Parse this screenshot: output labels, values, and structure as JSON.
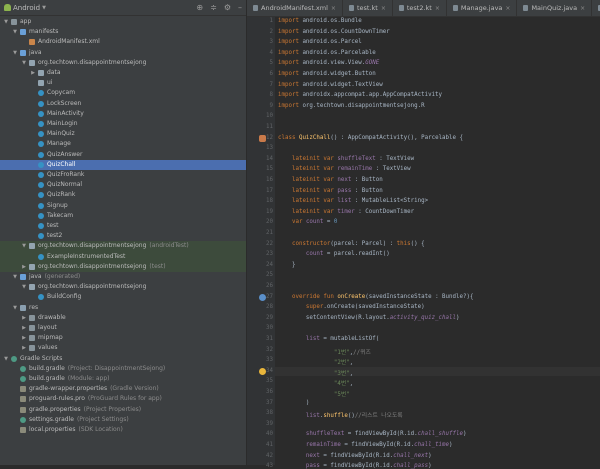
{
  "project": {
    "view_mode": "Android",
    "tree": [
      {
        "label": "app",
        "level": 0,
        "icon": "folder",
        "arrow": "open"
      },
      {
        "label": "manifests",
        "level": 1,
        "icon": "folder-blue",
        "arrow": "open"
      },
      {
        "label": "AndroidManifest.xml",
        "level": 2,
        "icon": "xml",
        "arrow": ""
      },
      {
        "label": "java",
        "level": 1,
        "icon": "folder-blue",
        "arrow": "open"
      },
      {
        "label": "org.techtown.disappointmentsejong",
        "level": 2,
        "icon": "pkg",
        "arrow": "open"
      },
      {
        "label": "data",
        "level": 3,
        "icon": "pkg",
        "arrow": "closed"
      },
      {
        "label": "ui",
        "level": 3,
        "icon": "pkg",
        "arrow": ""
      },
      {
        "label": "Copycam",
        "level": 3,
        "icon": "cls",
        "arrow": ""
      },
      {
        "label": "LockScreen",
        "level": 3,
        "icon": "cls",
        "arrow": ""
      },
      {
        "label": "MainActivity",
        "level": 3,
        "icon": "cls",
        "arrow": ""
      },
      {
        "label": "MainLogin",
        "level": 3,
        "icon": "cls",
        "arrow": ""
      },
      {
        "label": "MainQuiz",
        "level": 3,
        "icon": "cls",
        "arrow": ""
      },
      {
        "label": "Manage",
        "level": 3,
        "icon": "cls",
        "arrow": ""
      },
      {
        "label": "QuizAnswer",
        "level": 3,
        "icon": "cls",
        "arrow": ""
      },
      {
        "label": "QuizChall",
        "level": 3,
        "icon": "cls",
        "arrow": "",
        "selected": true
      },
      {
        "label": "QuizFroRank",
        "level": 3,
        "icon": "cls",
        "arrow": ""
      },
      {
        "label": "QuizNormal",
        "level": 3,
        "icon": "cls",
        "arrow": ""
      },
      {
        "label": "QuizRank",
        "level": 3,
        "icon": "cls",
        "arrow": ""
      },
      {
        "label": "Signup",
        "level": 3,
        "icon": "cls",
        "arrow": ""
      },
      {
        "label": "Takecam",
        "level": 3,
        "icon": "cls",
        "arrow": ""
      },
      {
        "label": "test",
        "level": 3,
        "icon": "cls",
        "arrow": ""
      },
      {
        "label": "test2",
        "level": 3,
        "icon": "cls",
        "arrow": ""
      },
      {
        "label": "org.techtown.disappointmentsejong",
        "hint": "(androidTest)",
        "level": 2,
        "icon": "pkg",
        "arrow": "open",
        "test": true
      },
      {
        "label": "ExampleInstrumentedTest",
        "level": 3,
        "icon": "cls",
        "arrow": "",
        "test": true
      },
      {
        "label": "org.techtown.disappointmentsejong",
        "hint": "(test)",
        "level": 2,
        "icon": "pkg",
        "arrow": "closed",
        "test": true
      },
      {
        "label": "java",
        "hint": "(generated)",
        "level": 1,
        "icon": "folder-blue",
        "arrow": "open"
      },
      {
        "label": "org.techtown.disappointmentsejong",
        "level": 2,
        "icon": "pkg",
        "arrow": "open"
      },
      {
        "label": "BuildConfig",
        "level": 3,
        "icon": "cls",
        "arrow": ""
      },
      {
        "label": "res",
        "level": 1,
        "icon": "res",
        "arrow": "open"
      },
      {
        "label": "drawable",
        "level": 2,
        "icon": "folder",
        "arrow": "closed"
      },
      {
        "label": "layout",
        "level": 2,
        "icon": "folder",
        "arrow": "closed"
      },
      {
        "label": "mipmap",
        "level": 2,
        "icon": "folder",
        "arrow": "closed"
      },
      {
        "label": "values",
        "level": 2,
        "icon": "folder",
        "arrow": "closed"
      },
      {
        "label": "Gradle Scripts",
        "level": 0,
        "icon": "gradle",
        "arrow": "open"
      },
      {
        "label": "build.gradle",
        "hint": "(Project: DisappointmentSejong)",
        "level": 1,
        "icon": "gradle",
        "arrow": ""
      },
      {
        "label": "build.gradle",
        "hint": "(Module: app)",
        "level": 1,
        "icon": "gradle",
        "arrow": ""
      },
      {
        "label": "gradle-wrapper.properties",
        "hint": "(Gradle Version)",
        "level": 1,
        "icon": "file",
        "arrow": ""
      },
      {
        "label": "proguard-rules.pro",
        "hint": "(ProGuard Rules for app)",
        "level": 1,
        "icon": "file",
        "arrow": ""
      },
      {
        "label": "gradle.properties",
        "hint": "(Project Properties)",
        "level": 1,
        "icon": "file",
        "arrow": ""
      },
      {
        "label": "settings.gradle",
        "hint": "(Project Settings)",
        "level": 1,
        "icon": "gradle",
        "arrow": ""
      },
      {
        "label": "local.properties",
        "hint": "(SDK Location)",
        "level": 1,
        "icon": "file",
        "arrow": ""
      }
    ]
  },
  "tabs": [
    {
      "label": "AndroidManifest.xml",
      "active": false
    },
    {
      "label": "test.kt",
      "active": false
    },
    {
      "label": "test2.kt",
      "active": false
    },
    {
      "label": "Manage.java",
      "active": false
    },
    {
      "label": "MainQuiz.java",
      "active": false
    },
    {
      "label": "MainActivity.j",
      "active": false
    }
  ],
  "code": {
    "start_line": 1,
    "highlight_line": 34,
    "lines": [
      [
        [
          "kw",
          "import "
        ],
        [
          "",
          "android.os.Bundle"
        ]
      ],
      [
        [
          "kw",
          "import "
        ],
        [
          "",
          "android.os.CountDownTimer"
        ]
      ],
      [
        [
          "kw",
          "import "
        ],
        [
          "",
          "android.os.Parcel"
        ]
      ],
      [
        [
          "kw",
          "import "
        ],
        [
          "",
          "android.os.Parcelable"
        ]
      ],
      [
        [
          "kw",
          "import "
        ],
        [
          "",
          "android.view.View."
        ],
        [
          "ital",
          "GONE"
        ]
      ],
      [
        [
          "kw",
          "import "
        ],
        [
          "",
          "android.widget.Button"
        ]
      ],
      [
        [
          "kw",
          "import "
        ],
        [
          "",
          "android.widget.TextView"
        ]
      ],
      [
        [
          "kw",
          "import "
        ],
        [
          "",
          "androidx.appcompat.app.AppCompatActivity"
        ]
      ],
      [
        [
          "kw",
          "import "
        ],
        [
          "",
          "org.techtown.disappointmentsejong.R"
        ]
      ],
      [],
      [],
      [
        [
          "kw",
          "class "
        ],
        [
          "fn",
          "QuizChall"
        ],
        [
          "",
          "() : AppCompatActivity(), Parcelable {"
        ]
      ],
      [],
      [
        [
          "",
          "    "
        ],
        [
          "kw",
          "lateinit var "
        ],
        [
          "prop",
          "shuffleText"
        ],
        [
          "",
          " : TextView"
        ]
      ],
      [
        [
          "",
          "    "
        ],
        [
          "kw",
          "lateinit var "
        ],
        [
          "prop",
          "remainTime"
        ],
        [
          "",
          " : TextView"
        ]
      ],
      [
        [
          "",
          "    "
        ],
        [
          "kw",
          "lateinit var "
        ],
        [
          "prop",
          "next"
        ],
        [
          "",
          " : Button"
        ]
      ],
      [
        [
          "",
          "    "
        ],
        [
          "kw",
          "lateinit var "
        ],
        [
          "prop",
          "pass"
        ],
        [
          "",
          " : Button"
        ]
      ],
      [
        [
          "",
          "    "
        ],
        [
          "kw",
          "lateinit var "
        ],
        [
          "prop",
          "list"
        ],
        [
          "",
          " : MutableList<String>"
        ]
      ],
      [
        [
          "",
          "    "
        ],
        [
          "kw",
          "lateinit var "
        ],
        [
          "prop",
          "timer"
        ],
        [
          "",
          " : CountDownTimer"
        ]
      ],
      [
        [
          "",
          "    "
        ],
        [
          "kw",
          "var "
        ],
        [
          "prop",
          "count"
        ],
        [
          "",
          " = "
        ],
        [
          "num",
          "0"
        ]
      ],
      [],
      [
        [
          "",
          "    "
        ],
        [
          "kw",
          "constructor"
        ],
        [
          "",
          "(parcel: Parcel) : "
        ],
        [
          "kw",
          "this"
        ],
        [
          "",
          "() {"
        ]
      ],
      [
        [
          "",
          "        "
        ],
        [
          "prop",
          "count"
        ],
        [
          "",
          " = parcel.readInt()"
        ]
      ],
      [
        [
          "",
          "    }"
        ]
      ],
      [],
      [],
      [
        [
          "",
          "    "
        ],
        [
          "kw",
          "override fun "
        ],
        [
          "fn",
          "onCreate"
        ],
        [
          "",
          "(savedInstanceState : Bundle?){"
        ]
      ],
      [
        [
          "",
          "        "
        ],
        [
          "kw",
          "super"
        ],
        [
          "",
          ".onCreate(savedInstanceState)"
        ]
      ],
      [
        [
          "",
          "        setContentView(R.layout."
        ],
        [
          "ital",
          "activity_quiz_chall"
        ],
        [
          "",
          ")"
        ]
      ],
      [],
      [
        [
          "",
          "        "
        ],
        [
          "prop",
          "list"
        ],
        [
          "",
          " = mutableListOf("
        ]
      ],
      [
        [
          "",
          "                "
        ],
        [
          "str",
          "\"1번\""
        ],
        [
          "",
          ","
        ],
        [
          "cm",
          "//퀴즈"
        ]
      ],
      [
        [
          "",
          "                "
        ],
        [
          "str",
          "\"2번\""
        ],
        [
          "",
          ","
        ]
      ],
      [
        [
          "",
          "                "
        ],
        [
          "str",
          "\"3번\""
        ],
        [
          "",
          ","
        ]
      ],
      [
        [
          "",
          "                "
        ],
        [
          "str",
          "\"4번\""
        ],
        [
          "",
          ","
        ]
      ],
      [
        [
          "",
          "                "
        ],
        [
          "str",
          "\"5번\""
        ]
      ],
      [
        [
          "",
          "        )"
        ]
      ],
      [
        [
          "",
          "        "
        ],
        [
          "prop",
          "list"
        ],
        [
          "",
          "."
        ],
        [
          "fn",
          "shuffle"
        ],
        [
          "",
          "()"
        ],
        [
          "cm",
          "//리스트 나오도록"
        ]
      ],
      [],
      [
        [
          "",
          "        "
        ],
        [
          "prop",
          "shuffleText"
        ],
        [
          "",
          " = findViewById(R.id."
        ],
        [
          "ital",
          "chall_shuffle"
        ],
        [
          "",
          ")"
        ]
      ],
      [
        [
          "",
          "        "
        ],
        [
          "prop",
          "remainTime"
        ],
        [
          "",
          " = findViewById(R.id."
        ],
        [
          "ital",
          "chall_time"
        ],
        [
          "",
          ")"
        ]
      ],
      [
        [
          "",
          "        "
        ],
        [
          "prop",
          "next"
        ],
        [
          "",
          " = findViewById(R.id."
        ],
        [
          "ital",
          "chall_next"
        ],
        [
          "",
          ")"
        ]
      ],
      [
        [
          "",
          "        "
        ],
        [
          "prop",
          "pass"
        ],
        [
          "",
          " = findViewById(R.id."
        ],
        [
          "ital",
          "chall_pass"
        ],
        [
          "",
          ")"
        ]
      ]
    ]
  }
}
